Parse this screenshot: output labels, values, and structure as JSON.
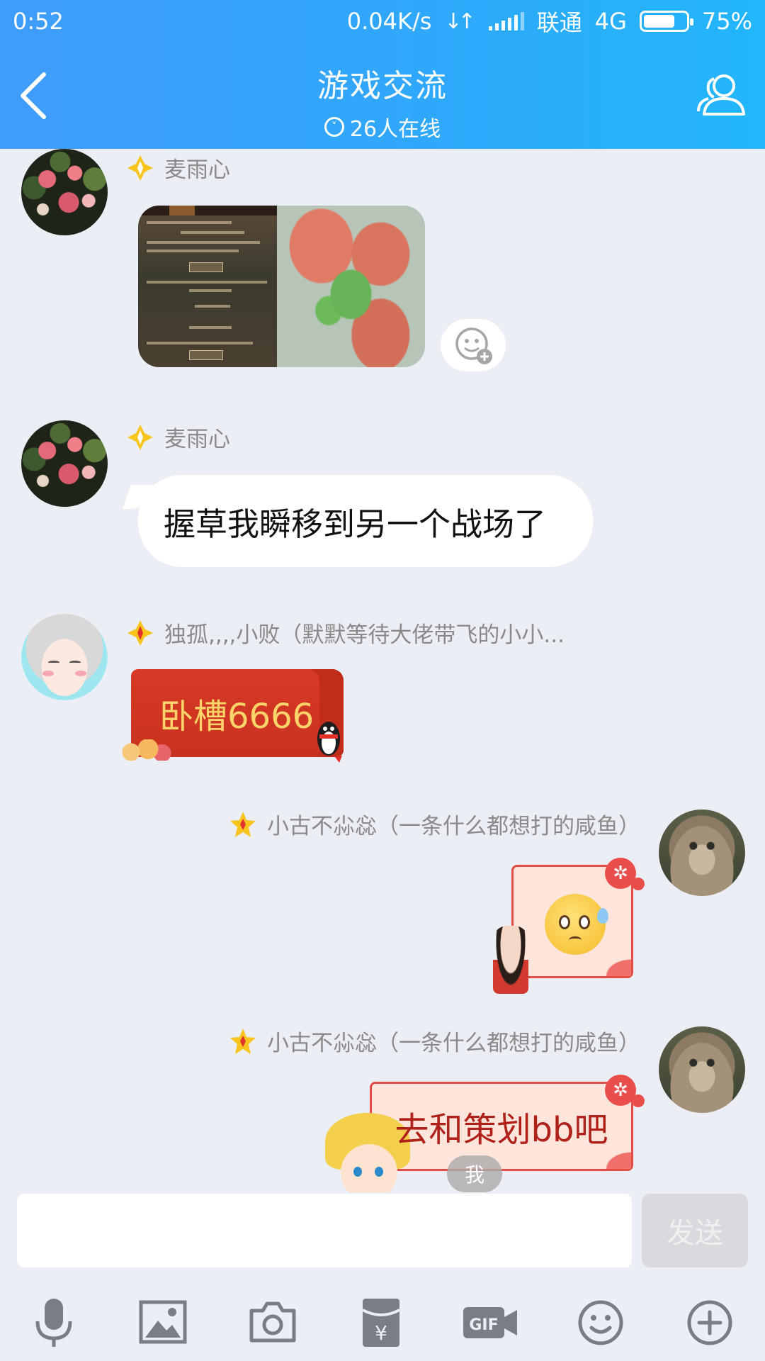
{
  "status_bar": {
    "time": "0:52",
    "net_speed": "0.04K/s",
    "carrier": "联通",
    "network": "4G",
    "battery": "75%",
    "battery_level": 0.75
  },
  "header": {
    "title": "游戏交流",
    "online_count": "26人在线",
    "accent_color": "#3f9cfb"
  },
  "messages": [
    {
      "sender": "麦雨心",
      "type": "image"
    },
    {
      "sender": "麦雨心",
      "type": "text",
      "text": "握草我瞬移到另一个战场了"
    },
    {
      "sender": "独孤,,,,小败（默默等待大佬带飞的小小...",
      "type": "red_packet",
      "text": "卧槽6666"
    },
    {
      "sender": "小古不尛惢（一条什么都想打的咸鱼）",
      "type": "sticker"
    },
    {
      "sender": "小古不尛惢（一条什么都想打的咸鱼）",
      "type": "text_card",
      "text": "去和策划bb吧",
      "self_label": "我"
    }
  ],
  "input": {
    "placeholder": "",
    "send_label": "发送"
  },
  "toolbar": {
    "icons": [
      "microphone-icon",
      "image-icon",
      "camera-icon",
      "red-packet-icon",
      "gif-icon",
      "emoji-icon",
      "plus-icon"
    ]
  }
}
